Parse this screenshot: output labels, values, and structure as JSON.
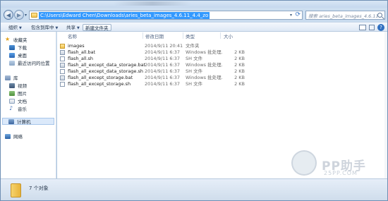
{
  "address": {
    "path": "C:\\Users\\Edward Chen\\Downloads\\aries_beta_images_4.6.11_4.4_zo"
  },
  "search": {
    "placeholder": "搜索 aries_beta_images_4.6.11_4.4..."
  },
  "toolbar": {
    "organize": "组织",
    "include_in_library": "包含到库中",
    "share": "共享",
    "new_folder": "新建文件夹"
  },
  "sidebar": {
    "favorites": "收藏夹",
    "downloads": "下载",
    "desktop": "桌面",
    "recent": "最近访问的位置",
    "libraries": "库",
    "videos": "视频",
    "pictures": "图片",
    "documents": "文档",
    "music": "音乐",
    "computer": "计算机",
    "network": "网络"
  },
  "columns": {
    "name": "名称",
    "date": "修改日期",
    "type": "类型",
    "size": "大小"
  },
  "files": [
    {
      "name": "images",
      "date": "2014/9/11 20:41",
      "type": "文件夹",
      "size": "",
      "icon": "folder-icon"
    },
    {
      "name": "flash_all.bat",
      "date": "2014/9/11 6:37",
      "type": "Windows 批处理...",
      "size": "2 KB",
      "icon": "bat-file-icon"
    },
    {
      "name": "flash_all.sh",
      "date": "2014/9/11 6:37",
      "type": "SH 文件",
      "size": "2 KB",
      "icon": "sh-file-icon"
    },
    {
      "name": "flash_all_except_data_storage.bat",
      "date": "2014/9/11 6:37",
      "type": "Windows 批处理...",
      "size": "2 KB",
      "icon": "bat-file-icon"
    },
    {
      "name": "flash_all_except_data_storage.sh",
      "date": "2014/9/11 6:37",
      "type": "SH 文件",
      "size": "2 KB",
      "icon": "sh-file-icon"
    },
    {
      "name": "flash_all_except_storage.bat",
      "date": "2014/9/11 6:37",
      "type": "Windows 批处理...",
      "size": "2 KB",
      "icon": "bat-file-icon"
    },
    {
      "name": "flash_all_except_storage.sh",
      "date": "2014/9/11 6:37",
      "type": "SH 文件",
      "size": "2 KB",
      "icon": "sh-file-icon"
    }
  ],
  "status": {
    "item_count": "7 个对象"
  },
  "watermark": {
    "brand": "PP助手",
    "site": "25PP.COM"
  }
}
